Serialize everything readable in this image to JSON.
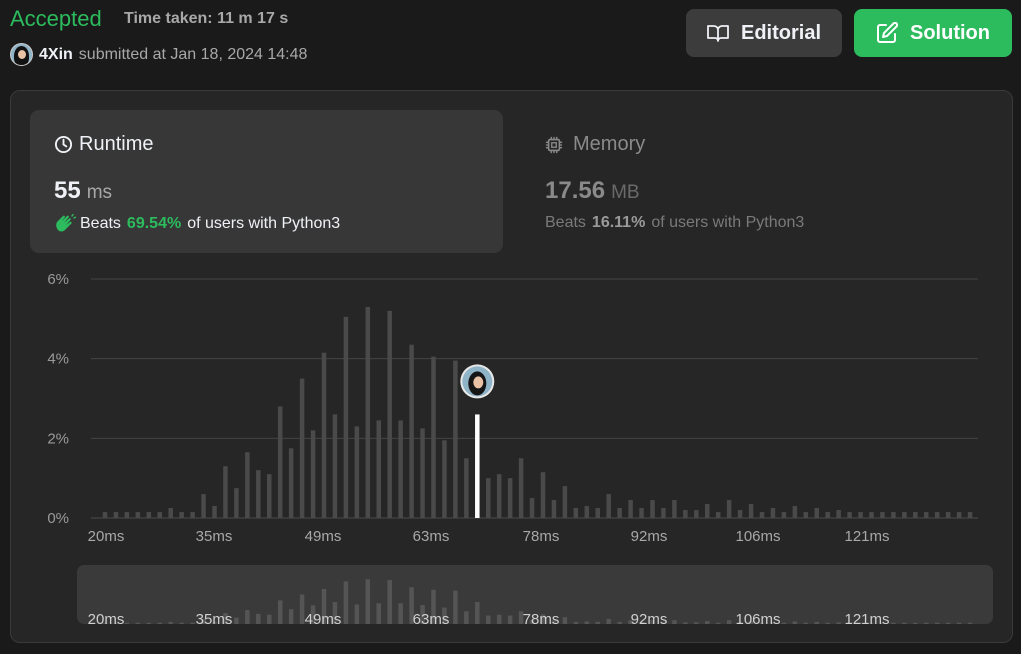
{
  "header": {
    "status": "Accepted",
    "time_taken": "Time taken: 11 m 17 s",
    "username": "4Xin",
    "submitted_text": "submitted at Jan 18, 2024 14:48",
    "editorial_label": "Editorial",
    "solution_label": "Solution"
  },
  "runtime": {
    "title": "Runtime",
    "value": "55",
    "unit": "ms",
    "beats_label": "Beats",
    "beats_pct": "69.54%",
    "beats_suffix": "of users with Python3"
  },
  "memory": {
    "title": "Memory",
    "value": "17.56",
    "unit": "MB",
    "beats_label": "Beats",
    "beats_pct": "16.11%",
    "beats_suffix": "of users with Python3"
  },
  "colors": {
    "accent_green": "#2cbb5d",
    "bar": "#4a4a4a",
    "highlight_bar": "#ffffff"
  },
  "chart_data": {
    "type": "bar",
    "title": "",
    "xlabel": "",
    "ylabel": "",
    "ylim": [
      0,
      6
    ],
    "y_ticks": [
      "0%",
      "2%",
      "4%",
      "6%"
    ],
    "x_tick_labels": [
      "20ms",
      "35ms",
      "49ms",
      "63ms",
      "78ms",
      "92ms",
      "106ms",
      "121ms"
    ],
    "highlight_index": 34,
    "highlight_label": "55 ms",
    "values": [
      0.15,
      0.15,
      0.15,
      0.15,
      0.15,
      0.15,
      0.25,
      0.15,
      0.15,
      0.6,
      0.3,
      1.3,
      0.75,
      1.65,
      1.2,
      1.1,
      2.8,
      1.75,
      3.5,
      2.2,
      4.15,
      2.6,
      5.05,
      2.3,
      5.3,
      2.45,
      5.2,
      2.45,
      4.35,
      2.25,
      4.05,
      1.95,
      3.95,
      1.5,
      2.6,
      1.0,
      1.1,
      1.0,
      1.5,
      0.5,
      1.15,
      0.45,
      0.8,
      0.25,
      0.3,
      0.25,
      0.6,
      0.25,
      0.45,
      0.25,
      0.45,
      0.25,
      0.45,
      0.2,
      0.2,
      0.35,
      0.15,
      0.45,
      0.2,
      0.35,
      0.15,
      0.25,
      0.15,
      0.3,
      0.15,
      0.25,
      0.15,
      0.2,
      0.15,
      0.15,
      0.15,
      0.15,
      0.15,
      0.15,
      0.15,
      0.15,
      0.15,
      0.15,
      0.15,
      0.15
    ]
  }
}
